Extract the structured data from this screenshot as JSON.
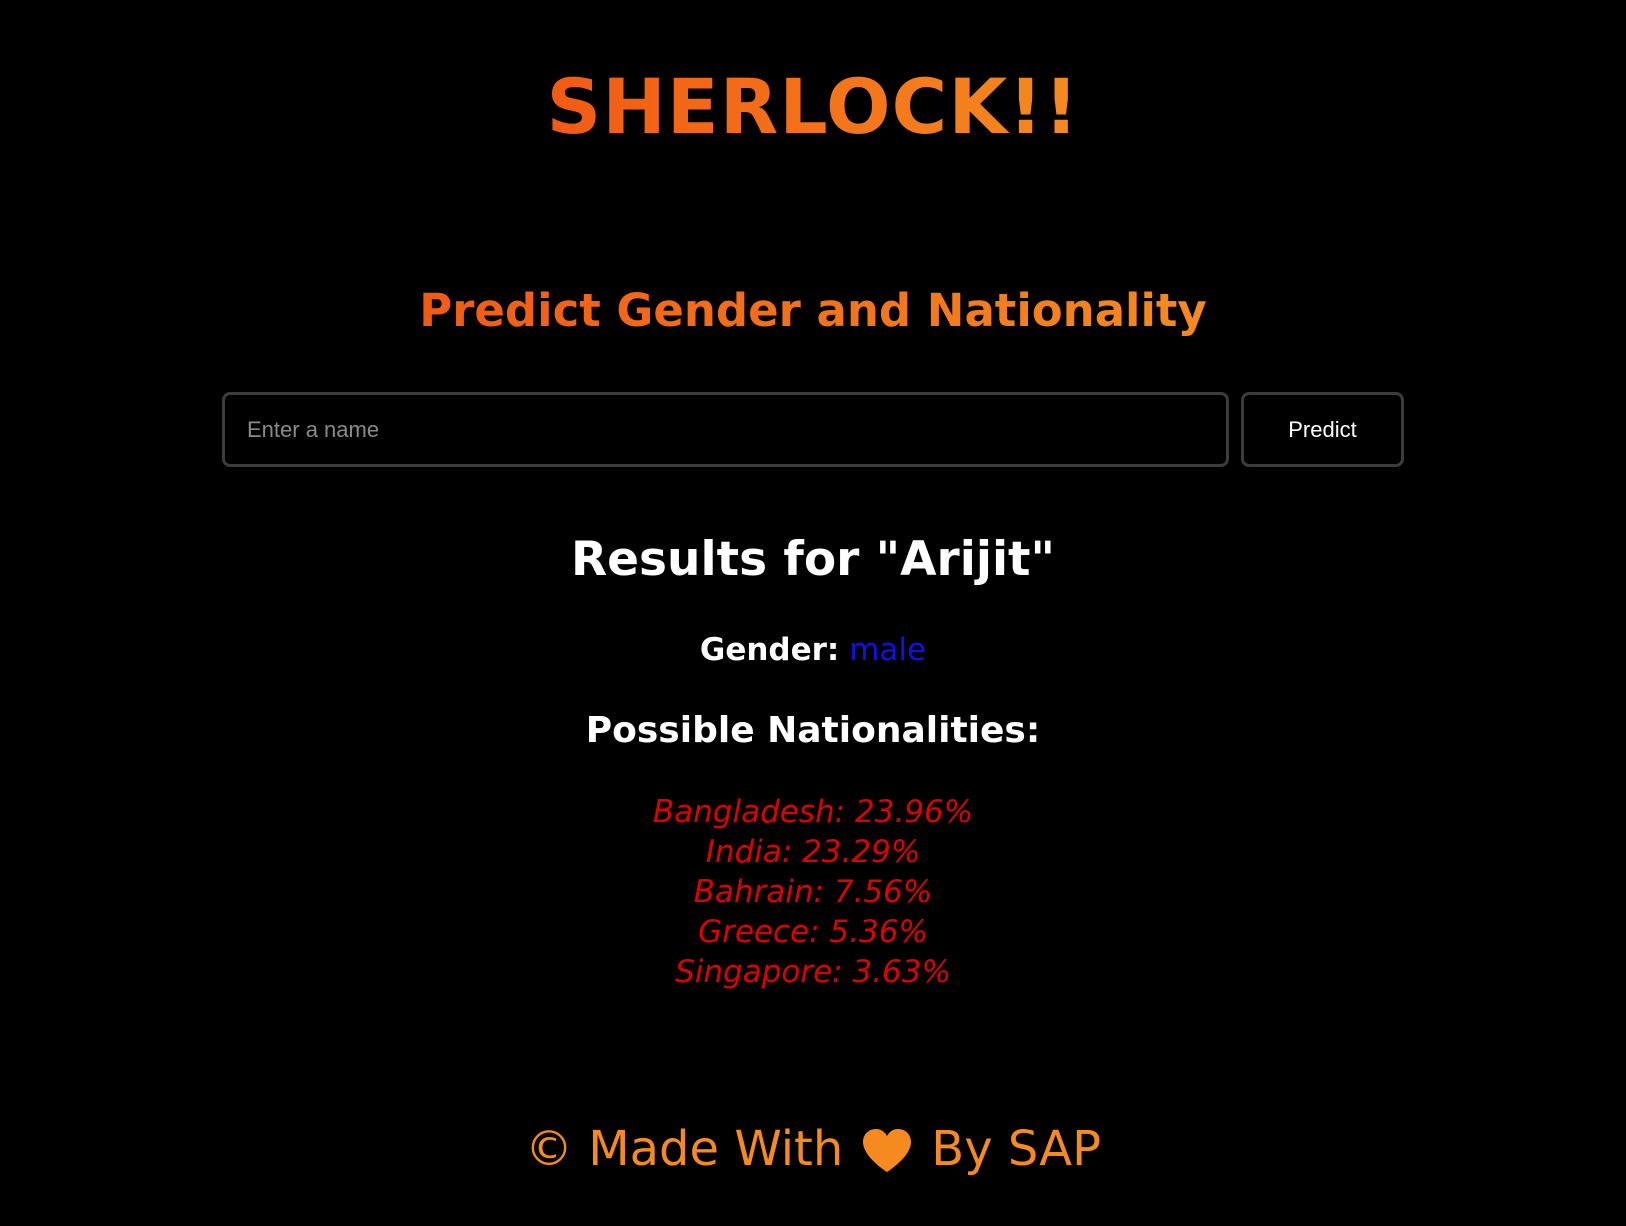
{
  "header": {
    "title": "SHERLOCK!!"
  },
  "hero": {
    "subtitle": "Predict Gender and Nationality"
  },
  "search": {
    "placeholder": "Enter a name",
    "value": "",
    "button_label": "Predict"
  },
  "results": {
    "title": "Results for \"Arijit\"",
    "gender_label": "Gender:",
    "gender_value": "male",
    "nationalities_title": "Possible Nationalities:",
    "nationalities": [
      "Bangladesh: 23.96%",
      "India: 23.29%",
      "Bahrain: 7.56%",
      "Greece: 5.36%",
      "Singapore: 3.63%"
    ]
  },
  "footer": {
    "prefix": "© Made With",
    "icon": "heart-icon",
    "suffix": "By SAP"
  },
  "colors": {
    "background": "#000000",
    "accent_start": "#f25a14",
    "accent_end": "#f58a1e",
    "gender_value": "#1010ee",
    "nationality_text": "#e00000"
  }
}
